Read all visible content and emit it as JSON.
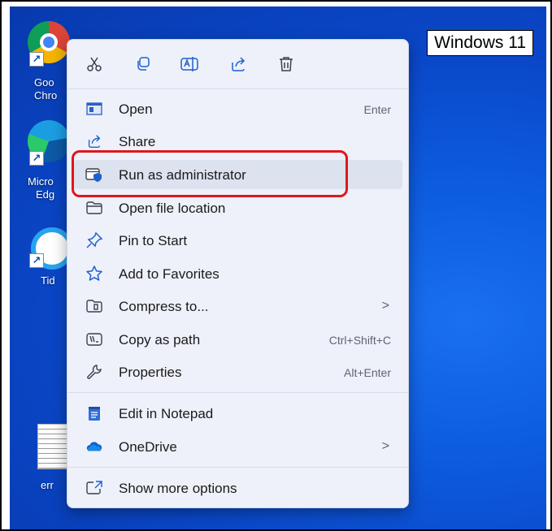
{
  "badge": {
    "text": "Windows 11"
  },
  "desktop_icons": [
    {
      "name": "chrome",
      "label_line1": "Goo",
      "label_line2": "Chro"
    },
    {
      "name": "edge",
      "label_line1": "Micro",
      "label_line2": "Edg"
    },
    {
      "name": "tide",
      "label_line1": "Tid"
    },
    {
      "name": "error-file",
      "label_line1": "err"
    }
  ],
  "toolbar": {
    "cut": "scissors-icon",
    "copy": "copy-icon",
    "rename": "rename-icon",
    "share": "share-icon",
    "delete": "trash-icon"
  },
  "menu": {
    "items": [
      {
        "label": "Open",
        "accel": "Enter",
        "icon": "open-window-icon"
      },
      {
        "label": "Share",
        "accel": "",
        "icon": "share-icon"
      },
      {
        "label": "Run as administrator",
        "accel": "",
        "icon": "shield-window-icon"
      },
      {
        "label": "Open file location",
        "accel": "",
        "icon": "folder-icon"
      },
      {
        "label": "Pin to Start",
        "accel": "",
        "icon": "pin-icon"
      },
      {
        "label": "Add to Favorites",
        "accel": "",
        "icon": "star-icon"
      },
      {
        "label": "Compress to...",
        "accel": "",
        "icon": "zip-icon",
        "submenu": ">"
      },
      {
        "label": "Copy as path",
        "accel": "Ctrl+Shift+C",
        "icon": "path-icon"
      },
      {
        "label": "Properties",
        "accel": "Alt+Enter",
        "icon": "wrench-icon"
      },
      {
        "label": "Edit in Notepad",
        "accel": "",
        "icon": "notepad-icon"
      },
      {
        "label": "OneDrive",
        "accel": "",
        "icon": "cloud-icon",
        "submenu": ">"
      },
      {
        "label": "Show more options",
        "accel": "",
        "icon": "more-options-icon"
      }
    ]
  },
  "colors": {
    "desktop": "#0d5ce0",
    "menu_bg": "#eef1f9",
    "hover_bg": "#dde2ef",
    "highlight": "#e0161c",
    "accent": "#1d5fd1"
  }
}
